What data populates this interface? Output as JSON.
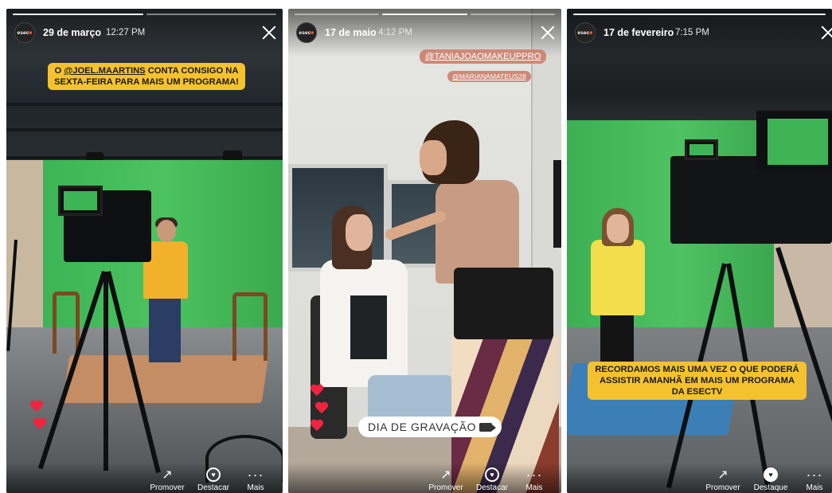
{
  "stories": [
    {
      "avatar": {
        "text": "esec",
        "accent": "■"
      },
      "date": "29 de março",
      "time": "12:27 PM",
      "caption": {
        "prefix": "O ",
        "mention": "@JOEL.MAARTINS",
        "rest": " CONTA CONSIGO NA SEXTA-FEIRA PARA MAIS UM PROGRAMA!"
      },
      "actions": [
        {
          "label": "Promover",
          "icon": "trend-up-icon"
        },
        {
          "label": "Destacar",
          "icon": "highlight-icon"
        },
        {
          "label": "Mais",
          "icon": "more-icon"
        }
      ]
    },
    {
      "avatar": {
        "text": "esec",
        "accent": "■"
      },
      "date": "17 de maio",
      "time": "4:12 PM",
      "mentions": [
        "@TANIAJOAOMAKEUPPRO",
        "@MARIANAMATEUS28"
      ],
      "sticker": "DIA DE GRAVAÇÃO",
      "actions": [
        {
          "label": "Promover",
          "icon": "trend-up-icon"
        },
        {
          "label": "Destacar",
          "icon": "highlight-icon"
        },
        {
          "label": "Mais",
          "icon": "more-icon"
        }
      ]
    },
    {
      "avatar": {
        "text": "esec",
        "accent": "■"
      },
      "date": "17 de fevereiro",
      "time": "7:15 PM",
      "caption": "RECORDAMOS MAIS UMA VEZ O QUE PODERÁ ASSISTIR AMANHÃ EM MAIS UM PROGRAMA DA ESECTV",
      "actions": [
        {
          "label": "Promover",
          "icon": "trend-up-icon"
        },
        {
          "label": "Destaque",
          "icon": "highlight-filled-icon"
        },
        {
          "label": "Mais",
          "icon": "more-icon"
        }
      ]
    }
  ],
  "colors": {
    "caption_bg": "#f4c22e",
    "mention_bg": "#cd826e",
    "heart": "#f0243f",
    "brand_accent": "#f25c2b"
  }
}
